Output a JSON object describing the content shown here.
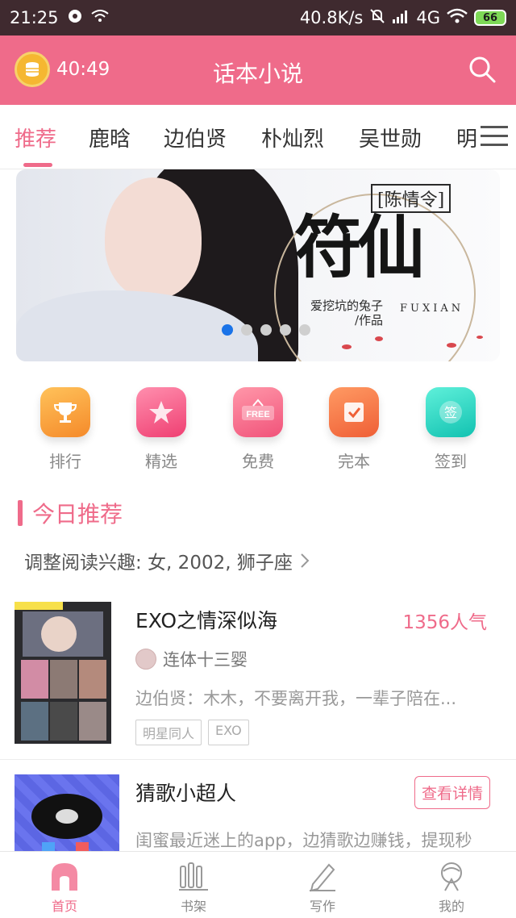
{
  "status_bar": {
    "time": "21:25",
    "network_speed": "40.8K/s",
    "network_type": "4G",
    "battery": "66"
  },
  "header": {
    "timer": "40:49",
    "title": "话本小说"
  },
  "tabs": [
    {
      "label": "推荐",
      "active": true
    },
    {
      "label": "鹿晗",
      "active": false
    },
    {
      "label": "边伯贤",
      "active": false
    },
    {
      "label": "朴灿烈",
      "active": false
    },
    {
      "label": "吴世勋",
      "active": false
    },
    {
      "label": "明",
      "active": false
    }
  ],
  "banner": {
    "title": "陈情令",
    "calligraphy": "符仙",
    "author_line1": "爱挖坑的兔子",
    "author_line2": "/作品",
    "latin": "FUXIAN",
    "dots": 5,
    "active_dot": 0
  },
  "quick_menu": [
    {
      "label": "排行",
      "icon": "trophy-icon",
      "color": "#f7a23c"
    },
    {
      "label": "精选",
      "icon": "star-icon",
      "color": "#f05a85"
    },
    {
      "label": "免费",
      "icon": "free-icon",
      "color": "#f56a86"
    },
    {
      "label": "完本",
      "icon": "check-icon",
      "color": "#f47e4a"
    },
    {
      "label": "签到",
      "icon": "checkin-icon",
      "color": "#2fd6c5"
    }
  ],
  "section": {
    "title": "今日推荐",
    "interest": "调整阅读兴趣: 女, 2002, 狮子座"
  },
  "books": [
    {
      "title": "EXO之情深似海",
      "popularity": "1356人气",
      "author": "连体十三婴",
      "description": "边伯贤：木木，不要离开我，一辈子陪在...",
      "tags": [
        "明星同人",
        "EXO"
      ]
    }
  ],
  "ad": {
    "title": "猜歌小超人",
    "button": "查看详情",
    "description": "闺蜜最近迷上的app，边猜歌边赚钱，提现秒"
  },
  "bottom_nav": [
    {
      "label": "首页",
      "icon": "home-icon",
      "active": true
    },
    {
      "label": "书架",
      "icon": "bookshelf-icon",
      "active": false
    },
    {
      "label": "写作",
      "icon": "pen-icon",
      "active": false
    },
    {
      "label": "我的",
      "icon": "profile-icon",
      "active": false
    }
  ],
  "colors": {
    "brand_pink": "#ef6b8a",
    "status_bar": "#3f2a2f"
  }
}
